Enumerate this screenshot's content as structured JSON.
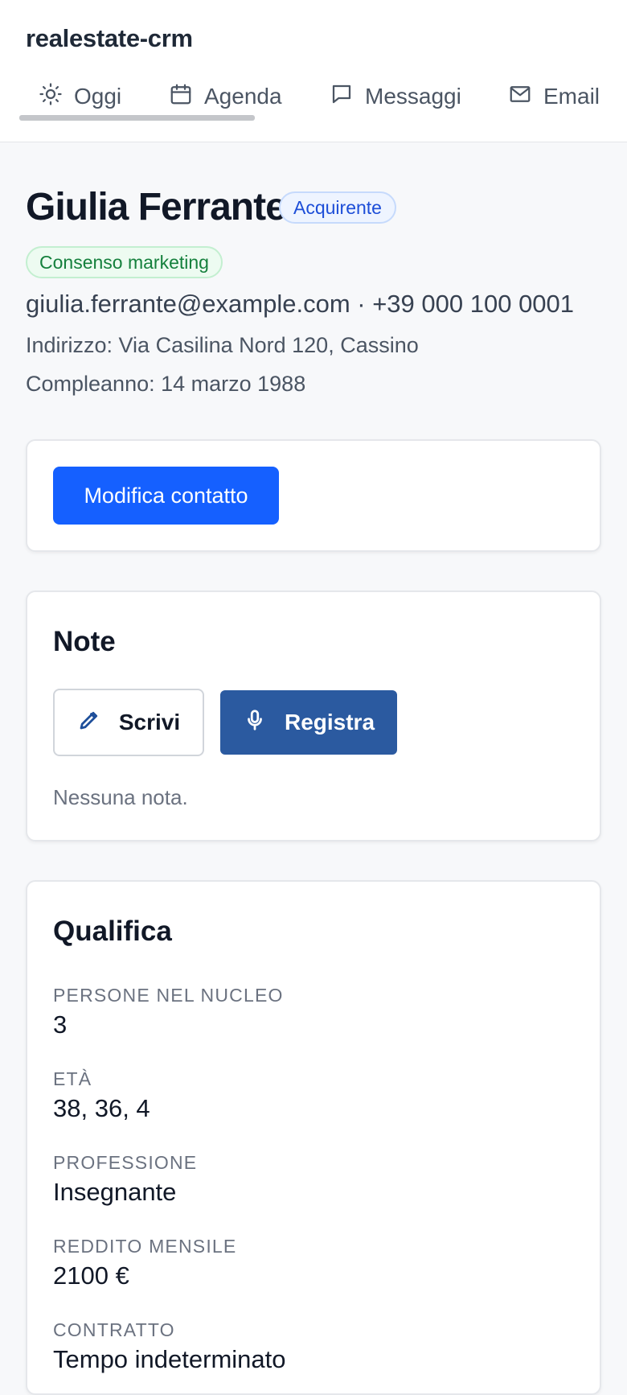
{
  "app": {
    "title": "realestate-crm"
  },
  "nav": {
    "tabs": [
      {
        "label": "Oggi",
        "icon": "sun-icon",
        "active": true
      },
      {
        "label": "Agenda",
        "icon": "calendar-icon"
      },
      {
        "label": "Messaggi",
        "icon": "chat-icon"
      },
      {
        "label": "Email",
        "icon": "mail-icon"
      }
    ]
  },
  "contact": {
    "name": "Giulia Ferrante",
    "role_badge": "Acquirente",
    "consent_badge": "Consenso marketing",
    "email_phone": "giulia.ferrante@example.com · +39 000 100 0001",
    "address": "Indirizzo: Via Casilina Nord 120, Cassino",
    "birthday": "Compleanno: 14 marzo 1988"
  },
  "actions": {
    "edit_label": "Modifica contatto"
  },
  "notes": {
    "title": "Note",
    "write_label": "Scrivi",
    "record_label": "Registra",
    "empty": "Nessuna nota."
  },
  "qualification": {
    "title": "Qualifica",
    "fields": [
      {
        "label": "Persone nel nucleo",
        "value": "3"
      },
      {
        "label": "Età",
        "value": "38, 36, 4"
      },
      {
        "label": "Professione",
        "value": "Insegnante"
      },
      {
        "label": "Reddito mensile",
        "value": "2100 €"
      },
      {
        "label": "Contratto",
        "value": "Tempo indeterminato"
      }
    ]
  },
  "colors": {
    "primary": "#1560ff",
    "record_button": "#2b5aa0",
    "role_badge": "#1d4ed8",
    "consent_badge": "#15803d"
  }
}
